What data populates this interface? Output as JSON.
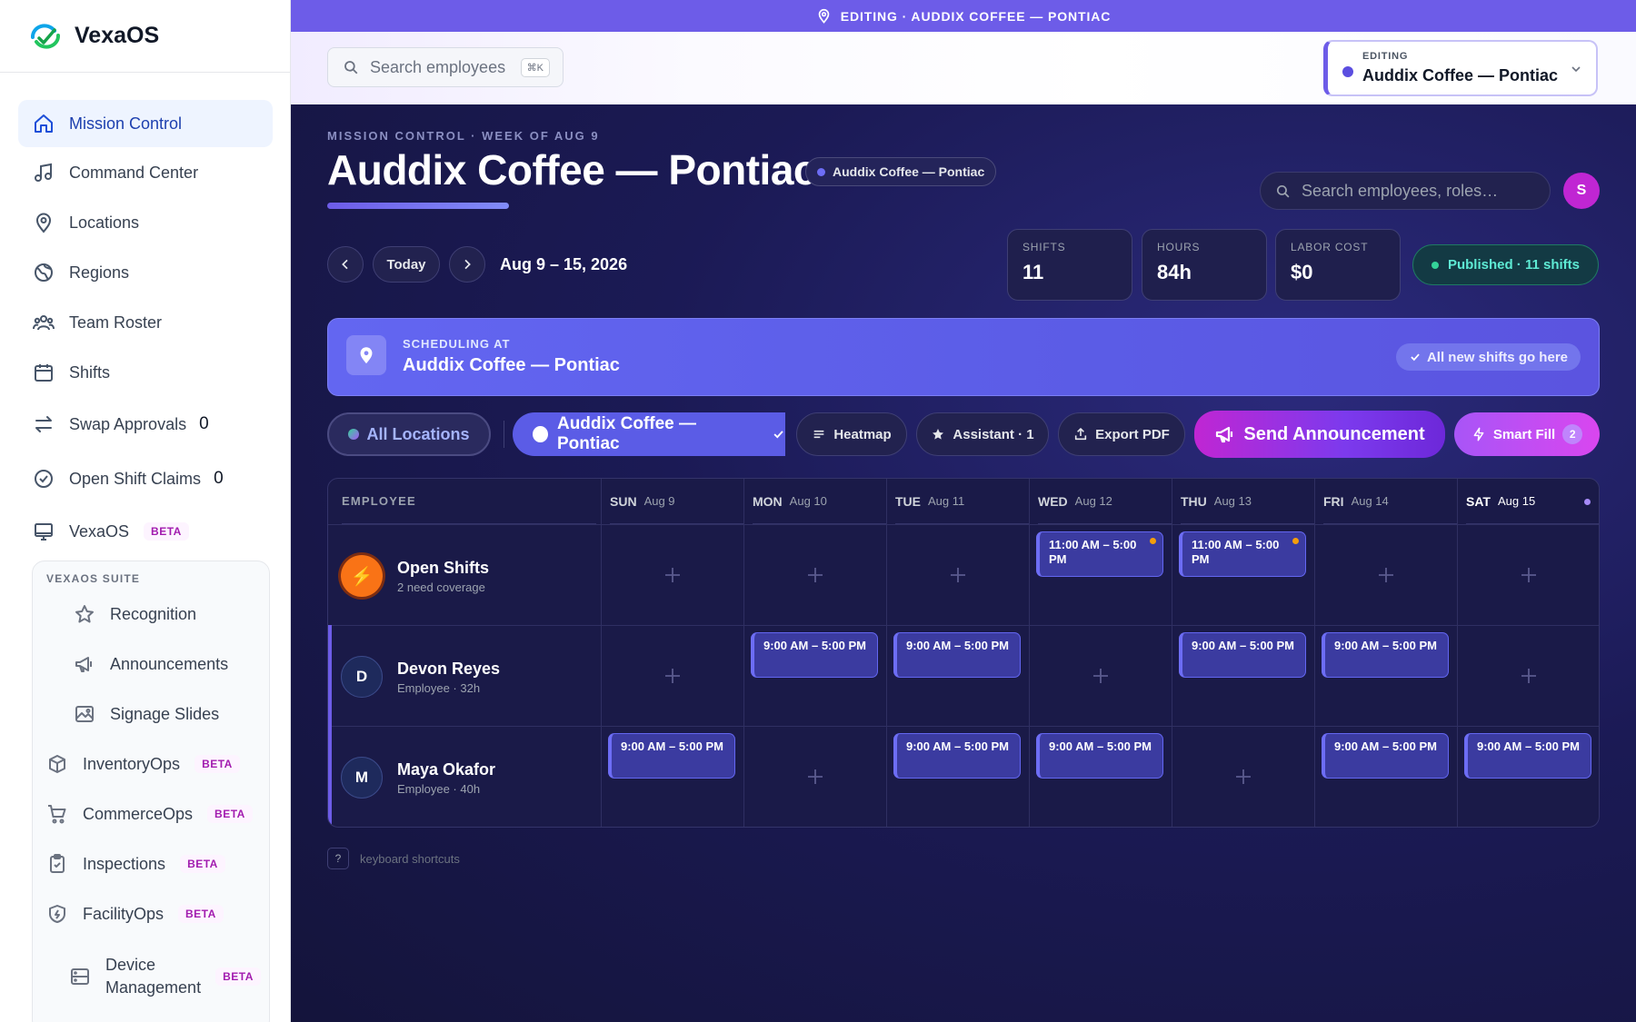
{
  "brand": {
    "name": "VexaOS"
  },
  "sidebar": {
    "items": [
      {
        "label": "Mission Control"
      },
      {
        "label": "Command Center"
      },
      {
        "label": "Locations"
      },
      {
        "label": "Regions"
      },
      {
        "label": "Team Roster"
      },
      {
        "label": "Shifts"
      },
      {
        "label": "Swap Approvals",
        "count": "0"
      },
      {
        "label": "Open Shift Claims",
        "count": "0"
      },
      {
        "label": "VexaOS",
        "badge": "BETA"
      }
    ],
    "suite": {
      "label": "VEXAOS SUITE",
      "items": [
        {
          "label": "Recognition"
        },
        {
          "label": "Announcements"
        },
        {
          "label": "Signage Slides"
        },
        {
          "label": "InventoryOps",
          "badge": "BETA"
        },
        {
          "label": "CommerceOps",
          "badge": "BETA"
        },
        {
          "label": "Inspections",
          "badge": "BETA"
        },
        {
          "label": "FacilityOps",
          "badge": "BETA"
        },
        {
          "label": "Device\nManagement",
          "badge": "BETA"
        }
      ]
    }
  },
  "banner": {
    "text": "EDITING · AUDDIX COFFEE — PONTIAC"
  },
  "header": {
    "search_placeholder": "Search employees",
    "search_shortcut": "⌘K",
    "editing_label": "EDITING",
    "editing_value": "Auddix Coffee — Pontiac"
  },
  "main": {
    "kicker": "MISSION CONTROL · WEEK OF AUG 9",
    "title": "Auddix Coffee — Pontiac",
    "title_badge": "Auddix Coffee — Pontiac",
    "search_placeholder": "Search employees, roles…",
    "avatar_initial": "S",
    "today_label": "Today",
    "date_range": "Aug 9 – 15, 2026",
    "stats": [
      {
        "label": "SHIFTS",
        "value": "11"
      },
      {
        "label": "HOURS",
        "value": "84h"
      },
      {
        "label": "LABOR COST",
        "value": "$0"
      }
    ],
    "published": "Published · 11 shifts",
    "scheduling": {
      "label": "SCHEDULING AT",
      "value": "Auddix Coffee — Pontiac",
      "chip": "All new shifts go here"
    },
    "toolbar": {
      "all_locations": "All Locations",
      "current_location": "Auddix Coffee — Pontiac",
      "heatmap": "Heatmap",
      "assistant": "Assistant · 1",
      "export": "Export PDF",
      "announce": "Send Announcement",
      "smart_fill": "Smart Fill",
      "smart_fill_count": "2"
    },
    "schedule": {
      "employee_header": "EMPLOYEE",
      "days": [
        {
          "dow": "SUN",
          "date": "Aug 9"
        },
        {
          "dow": "MON",
          "date": "Aug 10"
        },
        {
          "dow": "TUE",
          "date": "Aug 11"
        },
        {
          "dow": "WED",
          "date": "Aug 12"
        },
        {
          "dow": "THU",
          "date": "Aug 13"
        },
        {
          "dow": "FRI",
          "date": "Aug 14"
        },
        {
          "dow": "SAT",
          "date": "Aug 15"
        }
      ],
      "rows": [
        {
          "name": "Open Shifts",
          "sub": "2 need coverage",
          "initial": "⚡",
          "shifts": [
            "",
            "",
            "",
            "11:00 AM – 5:00 PM",
            "11:00 AM – 5:00 PM",
            "",
            ""
          ]
        },
        {
          "name": "Devon Reyes",
          "sub": "Employee · 32h",
          "initial": "D",
          "shifts": [
            "",
            "9:00 AM – 5:00 PM",
            "9:00 AM – 5:00 PM",
            "",
            "9:00 AM – 5:00 PM",
            "9:00 AM – 5:00 PM",
            ""
          ]
        },
        {
          "name": "Maya Okafor",
          "sub": "Employee · 40h",
          "initial": "M",
          "shifts": [
            "9:00 AM – 5:00 PM",
            "",
            "9:00 AM – 5:00 PM",
            "9:00 AM – 5:00 PM",
            "",
            "9:00 AM – 5:00 PM",
            "9:00 AM – 5:00 PM"
          ]
        }
      ]
    },
    "kbd_key": "?",
    "kbd_label": "keyboard shortcuts"
  }
}
